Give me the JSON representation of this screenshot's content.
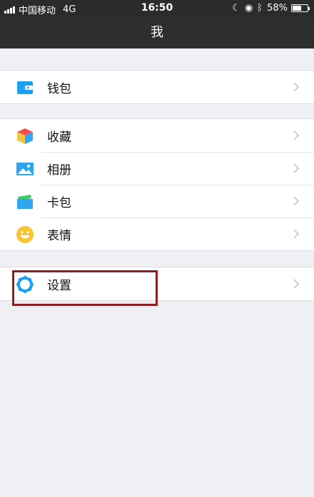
{
  "status_bar": {
    "carrier": "中国移动",
    "network": "4G",
    "time": "16:50",
    "battery_percent": "58%",
    "battery_level": 0.58
  },
  "nav": {
    "title": "我"
  },
  "groups": [
    [
      {
        "label": "钱包",
        "icon": "wallet-icon"
      }
    ],
    [
      {
        "label": "收藏",
        "icon": "favorites-cube-icon"
      },
      {
        "label": "相册",
        "icon": "photo-album-icon"
      },
      {
        "label": "卡包",
        "icon": "card-pack-icon"
      },
      {
        "label": "表情",
        "icon": "smiley-icon"
      }
    ],
    [
      {
        "label": "设置",
        "icon": "settings-gear-icon"
      }
    ]
  ],
  "colors": {
    "background": "#efeff4",
    "nav": "#2e2e2e",
    "highlight_box": "#8f1f1f",
    "icon_blue": "#1da0f2",
    "chevron": "#c7c7cc"
  }
}
